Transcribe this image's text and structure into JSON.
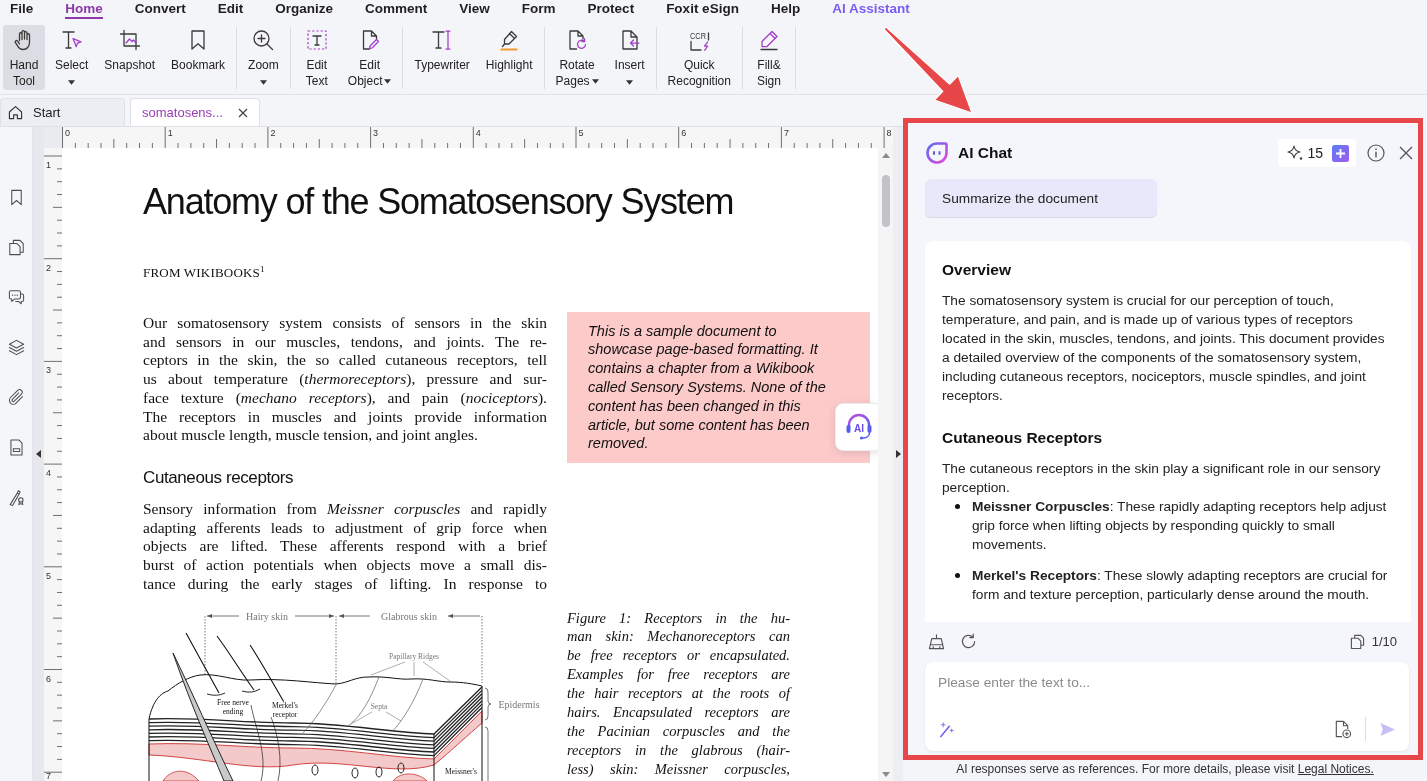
{
  "menu": [
    {
      "label": "File",
      "selected": false,
      "kind": "normal"
    },
    {
      "label": "Home",
      "selected": true,
      "kind": "normal"
    },
    {
      "label": "Convert",
      "selected": false,
      "kind": "normal"
    },
    {
      "label": "Edit",
      "selected": false,
      "kind": "normal"
    },
    {
      "label": "Organize",
      "selected": false,
      "kind": "normal"
    },
    {
      "label": "Comment",
      "selected": false,
      "kind": "normal"
    },
    {
      "label": "View",
      "selected": false,
      "kind": "normal"
    },
    {
      "label": "Form",
      "selected": false,
      "kind": "normal"
    },
    {
      "label": "Protect",
      "selected": false,
      "kind": "normal"
    },
    {
      "label": "Foxit eSign",
      "selected": false,
      "kind": "normal"
    },
    {
      "label": "Help",
      "selected": false,
      "kind": "normal"
    },
    {
      "label": "AI Assistant",
      "selected": false,
      "kind": "ai"
    }
  ],
  "ribbon": [
    [
      {
        "label": [
          "Hand",
          "Tool"
        ],
        "dropdown": false,
        "selected": true
      },
      {
        "label": [
          "Select"
        ],
        "dropdown": true,
        "selected": false
      },
      {
        "label": [
          "Snapshot"
        ],
        "dropdown": false,
        "selected": false
      },
      {
        "label": [
          "Bookmark"
        ],
        "dropdown": false,
        "selected": false
      }
    ],
    [
      {
        "label": [
          "Zoom"
        ],
        "dropdown": true,
        "selected": false
      }
    ],
    [
      {
        "label": [
          "Edit",
          "Text"
        ],
        "dropdown": false,
        "selected": false
      },
      {
        "label": [
          "Edit",
          "Object"
        ],
        "dropdown": true,
        "selected": false
      }
    ],
    [
      {
        "label": [
          "Typewriter"
        ],
        "dropdown": false,
        "selected": false
      },
      {
        "label": [
          "Highlight"
        ],
        "dropdown": false,
        "selected": false
      }
    ],
    [
      {
        "label": [
          "Rotate",
          "Pages"
        ],
        "dropdown": true,
        "selected": false
      },
      {
        "label": [
          "Insert"
        ],
        "dropdown": true,
        "selected": false
      }
    ],
    [
      {
        "label": [
          "Quick",
          "Recognition"
        ],
        "dropdown": false,
        "selected": false,
        "icon_text": "CCR"
      }
    ],
    [
      {
        "label": [
          "Fill&",
          "Sign"
        ],
        "dropdown": false,
        "selected": false
      }
    ]
  ],
  "tabs": [
    {
      "label": "Start",
      "kind": "start",
      "selected": false
    },
    {
      "label": "somatosens...",
      "kind": "document",
      "selected": true
    }
  ],
  "ruler": {
    "horizontal": [
      "0",
      "1",
      "2",
      "3",
      "4",
      "5",
      "6",
      "7",
      "8"
    ],
    "vertical": [
      "1",
      "2",
      "3",
      "4",
      "5",
      "6",
      "7"
    ]
  },
  "document": {
    "title": "Anatomy of the Somatosensory System",
    "byline": "FROM WIKIBOOKS$^{1}$",
    "intro": {
      "lines": [
        "Our somatosensory system consists of sensors in the skin",
        "and sensors in our muscles, tendons, and joints. The re-",
        "ceptors in the skin, the so called cutaneous receptors, tell",
        "us about temperature (*thermoreceptors*), pressure and sur-",
        "face texture (*mechano receptors*), and pain (*nociceptors*).",
        "The receptors in muscles and joints provide information",
        "about muscle length, muscle tension, and joint angles."
      ],
      "continues": false
    },
    "section": {
      "heading": "Cutaneous receptors",
      "lines": [
        "Sensory information from *Meissner corpuscles* and rapidly",
        "adapting afferents leads to adjustment of grip force when",
        "objects are lifted. These afferents respond with a brief",
        "burst of action potentials when objects move a small dis-",
        "tance during the early stages of lifting. In response to"
      ],
      "continues": true
    },
    "note": {
      "lines": [
        "This is a sample document to",
        "showcase page-based formatting. It",
        "contains a chapter from a Wikibook",
        "called Sensory Systems. None of the",
        "content has been changed in this",
        "article, but some content has been",
        "removed."
      ]
    },
    "figure": {
      "labels": [
        {
          "lines": [
            "Hairy skin"
          ]
        },
        {
          "lines": [
            "Glabrous skin"
          ]
        },
        {
          "lines": [
            "Papillary Ridges"
          ]
        },
        {
          "lines": [
            "Free nerve",
            "ending"
          ]
        },
        {
          "lines": [
            "Merkel's",
            "receptor"
          ]
        },
        {
          "lines": [
            "Septa"
          ]
        },
        {
          "lines": [
            "Epidermis"
          ]
        },
        {
          "lines": [
            "Meissner's"
          ]
        }
      ]
    },
    "caption": {
      "lines": [
        "Figure 1: Receptors in the hu-",
        "man skin: Mechanoreceptors can",
        "be free receptors or encapsulated.",
        "Examples for free receptors are",
        "the hair receptors at the roots of",
        "hairs. Encapsulated receptors are",
        "the Pacinian corpuscles and the",
        "receptors in the glabrous (hair-",
        "less) skin: Meissner corpuscles,"
      ],
      "continues": true
    }
  },
  "ai_button": {
    "label": "AI"
  },
  "ai_panel": {
    "title": "AI Chat",
    "credits": "15",
    "prompt": "Summarize the document",
    "response": [
      {
        "heading": "Overview",
        "text": "The somatosensory system is crucial for our perception of touch, temperature, and pain, and is made up of various types of receptors located in the skin, muscles, tendons, and joints. This document provides a detailed overview of the components of the somatosensory system, including cutaneous receptors, nociceptors, muscle spindles, and joint receptors."
      },
      {
        "heading": "Cutaneous Receptors",
        "text": "The cutaneous receptors in the skin play a significant role in our sensory perception.",
        "bullets": [
          "**Meissner Corpuscles**: These rapidly adapting receptors help adjust grip force when lifting objects by responding quickly to small movements.",
          "**Merkel's Receptors**: These slowly adapting receptors are crucial for form and texture perception, particularly dense around the mouth."
        ]
      }
    ],
    "page_count": "1/10",
    "input": {
      "placeholder": "Please enter the text to..."
    },
    "send": {
      "disabled": true
    },
    "disclaimer": {
      "text": "AI responses serve as references. For more details, please visit",
      "link": "Legal Notices."
    }
  }
}
